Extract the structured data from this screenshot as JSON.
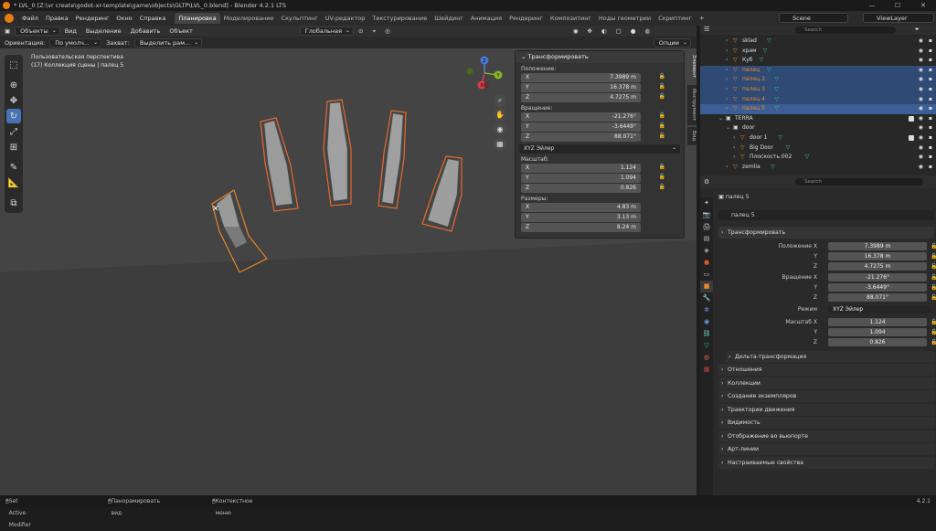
{
  "titlebar": {
    "title": "* LVL_0 [Z:\\vr create\\godot-xr-template\\game\\objects\\GLTP\\LVL_0.blend] - Blender 4.2.1 LTS"
  },
  "menu": [
    "Файл",
    "Правка",
    "Рендеринг",
    "Окно",
    "Справка"
  ],
  "workspaces": [
    "Планировка",
    "Моделирование",
    "Скульптинг",
    "UV-редактор",
    "Текстурирование",
    "Шейдинг",
    "Анимация",
    "Рендеринг",
    "Композитинг",
    "Ноды геометрии",
    "Скриптинг"
  ],
  "scene": {
    "scene_name": "Scene",
    "view_layer": "ViewLayer"
  },
  "vp_header": {
    "mode": "Объекты",
    "items": [
      "Вид",
      "Выделение",
      "Добавить",
      "Объект"
    ],
    "transform_space": "Глобальная"
  },
  "tool_header": {
    "orientation_label": "Ориентация:",
    "orientation_value": "По умолч...",
    "drag_label": "Захват:",
    "drag_value": "Выделить рам...",
    "options": "Опции"
  },
  "vp_info": {
    "line1": "Пользовательская перспектива",
    "line2": "(17) Коллекция сцены | палец 5"
  },
  "npanel": {
    "header": "Трансформировать",
    "location_label": "Положение:",
    "location": [
      {
        "axis": "X",
        "value": "7.3989 m"
      },
      {
        "axis": "Y",
        "value": "16.378 m"
      },
      {
        "axis": "Z",
        "value": "4.7275 m"
      }
    ],
    "rotation_label": "Вращение:",
    "rotation": [
      {
        "axis": "X",
        "value": "-21.276°"
      },
      {
        "axis": "Y",
        "value": "-3.6449°"
      },
      {
        "axis": "Z",
        "value": "88.071°"
      }
    ],
    "rotation_mode": "XYZ Эйлер",
    "scale_label": "Масштаб:",
    "scale": [
      {
        "axis": "X",
        "value": "1.124"
      },
      {
        "axis": "Y",
        "value": "1.094"
      },
      {
        "axis": "Z",
        "value": "0.826"
      }
    ],
    "dims_label": "Размеры:",
    "dims": [
      {
        "axis": "X",
        "value": "4.83 m"
      },
      {
        "axis": "Y",
        "value": "3.13 m"
      },
      {
        "axis": "Z",
        "value": "8.24 m"
      }
    ]
  },
  "sidetabs": [
    "Элемент",
    "Инструмент",
    "Вид"
  ],
  "gizmo": {
    "z": "Z",
    "y": "Y",
    "x": "X"
  },
  "outliner": {
    "search_placeholder": "Search",
    "rows": [
      {
        "name": "sklad",
        "indent": 1,
        "sel": false,
        "act": false
      },
      {
        "name": "храм",
        "indent": 1,
        "sel": false,
        "act": false
      },
      {
        "name": "Куб",
        "indent": 1,
        "sel": false,
        "act": false
      },
      {
        "name": "палец",
        "indent": 1,
        "sel": true,
        "act": false
      },
      {
        "name": "палец 2",
        "indent": 1,
        "sel": true,
        "act": false
      },
      {
        "name": "палец 3",
        "indent": 1,
        "sel": true,
        "act": false
      },
      {
        "name": "палец 4",
        "indent": 1,
        "sel": true,
        "act": false
      },
      {
        "name": "палец 5",
        "indent": 1,
        "sel": true,
        "act": true
      },
      {
        "name": "TERRA",
        "indent": 0,
        "sel": false,
        "act": false
      },
      {
        "name": "door",
        "indent": 1,
        "sel": false,
        "act": false
      },
      {
        "name": "door 1",
        "indent": 2,
        "sel": false,
        "act": false
      },
      {
        "name": "Big Door",
        "indent": 2,
        "sel": false,
        "act": false
      },
      {
        "name": "Плоскость.002",
        "indent": 2,
        "sel": false,
        "act": false
      },
      {
        "name": "zemlia",
        "indent": 1,
        "sel": false,
        "act": false
      }
    ]
  },
  "props": {
    "search_placeholder": "Search",
    "object_name": "палец 5",
    "data_name": "палец 5",
    "transform_header": "Трансформировать",
    "location_label": "Положение X",
    "location": [
      "7.3989 m",
      "16.378 m",
      "4.7275 m"
    ],
    "rotation_label": "Вращение X",
    "rotation": [
      "-21.276°",
      "-3.6449°",
      "88.071°"
    ],
    "mode_label": "Режим",
    "mode_value": "XYZ Эйлер",
    "scale_label": "Масштаб X",
    "scale": [
      "1.124",
      "1.094",
      "0.826"
    ],
    "axis_y": "Y",
    "axis_z": "Z",
    "delta": "Дельта-трансформация",
    "panels": [
      "Отношения",
      "Коллекции",
      "Создание экземпляров",
      "Траектории движения",
      "Видимость",
      "Отображение во вьюпорте",
      "Арт-линии",
      "Настраиваемые свойства"
    ]
  },
  "status": {
    "left": "Set Active Modifier",
    "mid": "Панорамировать вид",
    "right": "Контекстное меню",
    "version": "4.2.1"
  }
}
